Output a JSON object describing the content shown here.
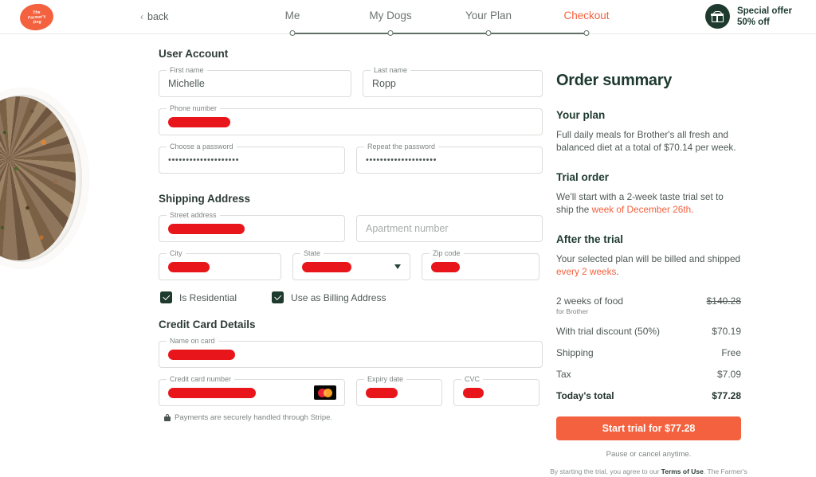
{
  "header": {
    "logo_text": "The Farmer's Dog",
    "logo_lines": [
      "The",
      "Farmer's",
      "Dog"
    ],
    "back_label": "back",
    "back_icon": "chevron-left-icon",
    "steps": [
      {
        "label": "Me",
        "active": false
      },
      {
        "label": "My Dogs",
        "active": false
      },
      {
        "label": "Your Plan",
        "active": false
      },
      {
        "label": "Checkout",
        "active": true
      }
    ],
    "offer": {
      "icon": "gift-icon",
      "line1": "Special offer",
      "line2": "50% off"
    }
  },
  "form": {
    "user_account": {
      "title": "User Account",
      "first_name": {
        "label": "First name",
        "value": "Michelle"
      },
      "last_name": {
        "label": "Last name",
        "value": "Ropp"
      },
      "phone": {
        "label": "Phone number",
        "value": "",
        "redacted": true,
        "redact_width": 78
      },
      "password": {
        "label": "Choose a password",
        "value": "••••••••••••••••••••"
      },
      "password_repeat": {
        "label": "Repeat the password",
        "value": "••••••••••••••••••••"
      }
    },
    "shipping": {
      "title": "Shipping Address",
      "street": {
        "label": "Street address",
        "value": "",
        "redacted": true,
        "redact_width": 96
      },
      "apartment": {
        "label": "",
        "placeholder": "Apartment number",
        "value": ""
      },
      "city": {
        "label": "City",
        "value": "",
        "redacted": true,
        "redact_width": 52
      },
      "state": {
        "label": "State",
        "value": "",
        "redacted": true,
        "redact_width": 62
      },
      "zip": {
        "label": "Zip code",
        "value": "",
        "redacted": true,
        "redact_width": 36
      },
      "checkbox_residential": {
        "label": "Is Residential",
        "checked": true
      },
      "checkbox_billing": {
        "label": "Use as Billing Address",
        "checked": true
      }
    },
    "credit_card": {
      "title": "Credit Card Details",
      "name_on_card": {
        "label": "Name on card",
        "value": "",
        "redacted": true,
        "redact_width": 84
      },
      "card_number": {
        "label": "Credit card number",
        "value": "",
        "redacted": true,
        "redact_width": 110,
        "brand": "mastercard"
      },
      "expiry": {
        "label": "Expiry date",
        "value": "",
        "redacted": true,
        "redact_width": 40
      },
      "cvc": {
        "label": "CVC",
        "value": "",
        "redacted": true,
        "redact_width": 26
      },
      "secure_note": "Payments are securely handled through Stripe.",
      "secure_icon": "lock-icon"
    }
  },
  "summary": {
    "title": "Order summary",
    "your_plan_heading": "Your plan",
    "your_plan_text": "Full daily meals for Brother's all fresh and balanced diet at a total of $70.14 per week.",
    "trial_heading": "Trial order",
    "trial_text_prefix": "We'll start with a 2-week taste trial set to ship the ",
    "trial_text_highlight": "week of December 26th.",
    "after_heading": "After the trial",
    "after_text_prefix": "Your selected plan will be billed and shipped ",
    "after_text_highlight": "every 2 weeks",
    "after_text_suffix": ".",
    "lines": [
      {
        "label": "2 weeks of food",
        "sub": "for Brother",
        "amount": "$140.28",
        "strike": true
      },
      {
        "label": "With trial discount (50%)",
        "sub": "",
        "amount": "$70.19",
        "strike": false
      },
      {
        "label": "Shipping",
        "sub": "",
        "amount": "Free",
        "strike": false
      },
      {
        "label": "Tax",
        "sub": "",
        "amount": "$7.09",
        "strike": false
      }
    ],
    "total": {
      "label": "Today's total",
      "amount": "$77.28"
    },
    "cta_label": "Start trial for $77.28",
    "pause_note": "Pause or cancel anytime.",
    "fine_print_prefix": "By starting the trial, you agree to our ",
    "fine_print_link": "Terms of Use",
    "fine_print_suffix": ". The Farmer's"
  },
  "colors": {
    "accent": "#f4613f",
    "dark_green": "#1e3a2f",
    "redaction": "#e8161b"
  }
}
